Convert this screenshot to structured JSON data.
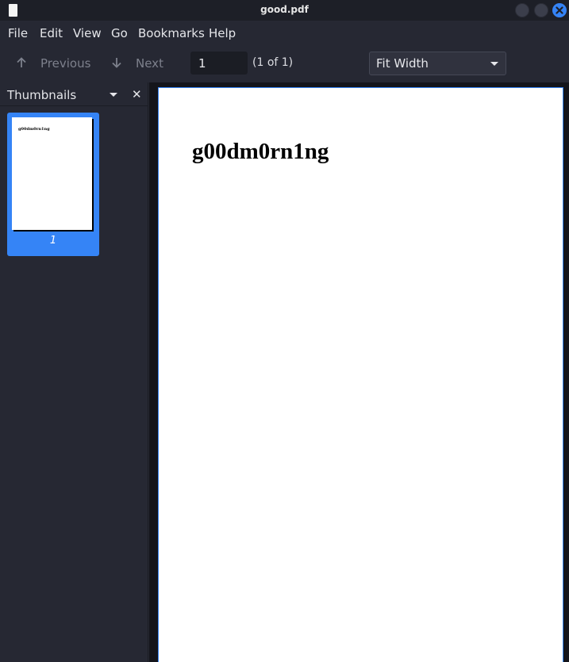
{
  "window": {
    "title": "good.pdf"
  },
  "menu": {
    "items": [
      "File",
      "Edit",
      "View",
      "Go",
      "Bookmarks",
      "Help"
    ]
  },
  "toolbar": {
    "previous_label": "Previous",
    "next_label": "Next",
    "page_value": "1",
    "page_count": "(1 of 1)",
    "zoom_value": "Fit Width"
  },
  "sidebar": {
    "title": "Thumbnails",
    "thumbnails": [
      {
        "page_label": "1",
        "preview_text": "g00dm0rn1ng"
      }
    ]
  },
  "document": {
    "heading": "g00dm0rn1ng"
  },
  "colors": {
    "accent": "#3584f6",
    "background": "#262833",
    "viewer_bg": "#14151b"
  }
}
